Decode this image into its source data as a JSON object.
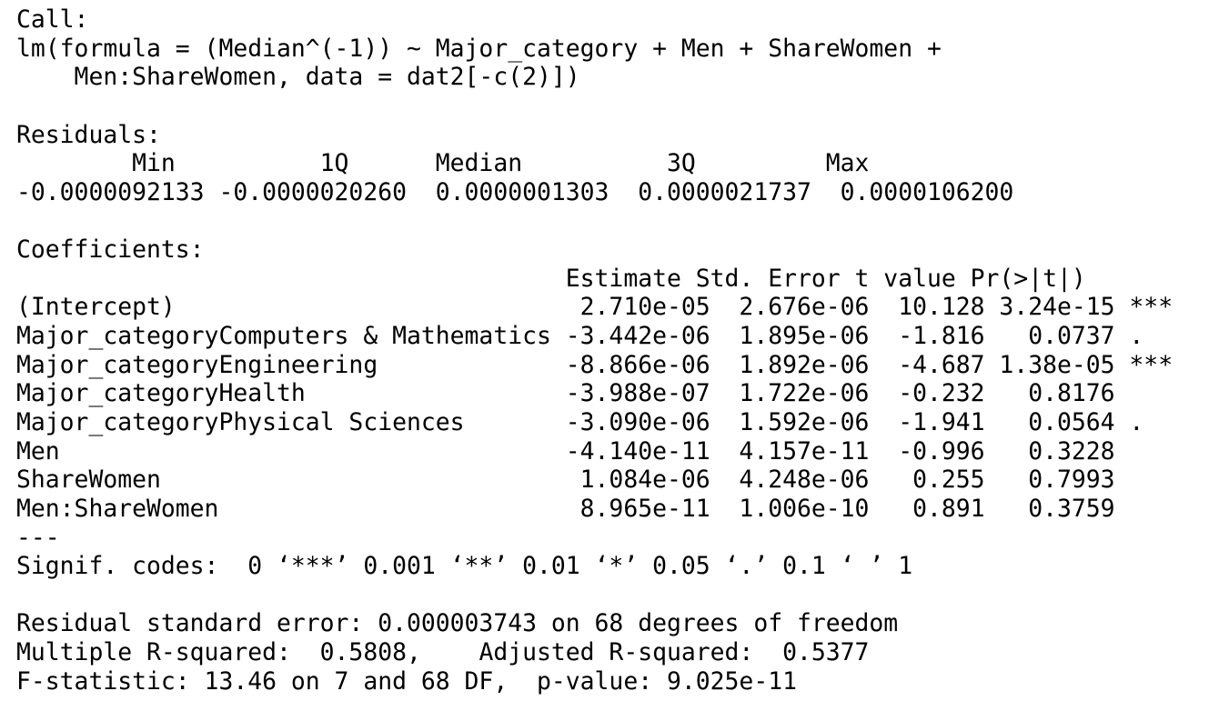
{
  "call": {
    "header": "Call:",
    "line1": "lm(formula = (Median^(-1)) ~ Major_category + Men + ShareWomen +",
    "line2": "    Men:ShareWomen, data = dat2[-c(2)])"
  },
  "residuals": {
    "header": "Residuals:",
    "labels_line": "        Min          1Q      Median          3Q         Max",
    "values_line": "-0.0000092133 -0.0000020260  0.0000001303  0.0000021737  0.0000106200",
    "labels": [
      "Min",
      "1Q",
      "Median",
      "3Q",
      "Max"
    ],
    "values": [
      "-0.0000092133",
      "-0.0000020260",
      "0.0000001303",
      "0.0000021737",
      "0.0000106200"
    ]
  },
  "coefficients": {
    "header": "Coefficients:",
    "columns_line": "                                      Estimate Std. Error t value Pr(>|t|)    ",
    "columns": [
      "Estimate",
      "Std. Error",
      "t value",
      "Pr(>|t|)"
    ],
    "rows": [
      {
        "text": "(Intercept)                            2.710e-05  2.676e-06  10.128 3.24e-15 ***",
        "term": "(Intercept)",
        "estimate": "2.710e-05",
        "std_error": "2.676e-06",
        "t_value": "10.128",
        "p_value": "3.24e-15",
        "signif": "***"
      },
      {
        "text": "Major_categoryComputers & Mathematics -3.442e-06  1.895e-06  -1.816   0.0737 .  ",
        "term": "Major_categoryComputers & Mathematics",
        "estimate": "-3.442e-06",
        "std_error": "1.895e-06",
        "t_value": "-1.816",
        "p_value": "0.0737",
        "signif": "."
      },
      {
        "text": "Major_categoryEngineering             -8.866e-06  1.892e-06  -4.687 1.38e-05 ***",
        "term": "Major_categoryEngineering",
        "estimate": "-8.866e-06",
        "std_error": "1.892e-06",
        "t_value": "-4.687",
        "p_value": "1.38e-05",
        "signif": "***"
      },
      {
        "text": "Major_categoryHealth                  -3.988e-07  1.722e-06  -0.232   0.8176    ",
        "term": "Major_categoryHealth",
        "estimate": "-3.988e-07",
        "std_error": "1.722e-06",
        "t_value": "-0.232",
        "p_value": "0.8176",
        "signif": ""
      },
      {
        "text": "Major_categoryPhysical Sciences       -3.090e-06  1.592e-06  -1.941   0.0564 .  ",
        "term": "Major_categoryPhysical Sciences",
        "estimate": "-3.090e-06",
        "std_error": "1.592e-06",
        "t_value": "-1.941",
        "p_value": "0.0564",
        "signif": "."
      },
      {
        "text": "Men                                   -4.140e-11  4.157e-11  -0.996   0.3228    ",
        "term": "Men",
        "estimate": "-4.140e-11",
        "std_error": "4.157e-11",
        "t_value": "-0.996",
        "p_value": "0.3228",
        "signif": ""
      },
      {
        "text": "ShareWomen                             1.084e-06  4.248e-06   0.255   0.7993    ",
        "term": "ShareWomen",
        "estimate": "1.084e-06",
        "std_error": "4.248e-06",
        "t_value": "0.255",
        "p_value": "0.7993",
        "signif": ""
      },
      {
        "text": "Men:ShareWomen                         8.965e-11  1.006e-10   0.891   0.3759    ",
        "term": "Men:ShareWomen",
        "estimate": "8.965e-11",
        "std_error": "1.006e-10",
        "t_value": "0.891",
        "p_value": "0.3759",
        "signif": ""
      }
    ],
    "separator": "---",
    "signif_codes": "Signif. codes:  0 ‘***’ 0.001 ‘**’ 0.01 ‘*’ 0.05 ‘.’ 0.1 ‘ ’ 1"
  },
  "summary": {
    "residual_se": "Residual standard error: 0.000003743 on 68 degrees of freedom",
    "r_squared": "Multiple R-squared:  0.5808,\tAdjusted R-squared:  0.5377 ",
    "f_statistic": "F-statistic: 13.46 on 7 and 68 DF,  p-value: 9.025e-11"
  }
}
